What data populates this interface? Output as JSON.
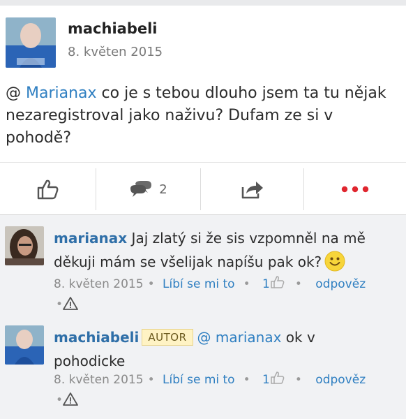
{
  "post": {
    "author": "machiabeli",
    "date": "8. květen 2015",
    "body_prefix": "@ ",
    "mention": "Marianax",
    "body_text": " co je s tebou dlouho jsem ta tu nějak nezaregistroval jako naživu? Dufam ze si v pohodě?"
  },
  "actions": {
    "like_icon": "thumbs-up-icon",
    "comment_icon": "comment-bubbles-icon",
    "comment_count": "2",
    "share_icon": "share-arrow-icon",
    "more_icon": "more-dots-icon",
    "accent": "#e0262f"
  },
  "comments": [
    {
      "author": "marianax",
      "text": " Jaj zlatý si že sis vzpomněl na mě děkuji mám se všelijak napíšu pak ok?",
      "date": "8. květen 2015",
      "like_label": "Líbí se mi to",
      "like_count": "1",
      "reply_label": "odpověz",
      "has_smiley": true
    },
    {
      "author": "machiabeli",
      "badge": "AUTOR",
      "mention": "@ marianax",
      "text": " ok v pohodicke",
      "date": "8. květen 2015",
      "like_label": "Líbí se mi to",
      "like_count": "1",
      "reply_label": "odpověz"
    }
  ],
  "colors": {
    "link": "#2f7fc1",
    "author": "#2f6fa8",
    "more": "#e0262f"
  }
}
